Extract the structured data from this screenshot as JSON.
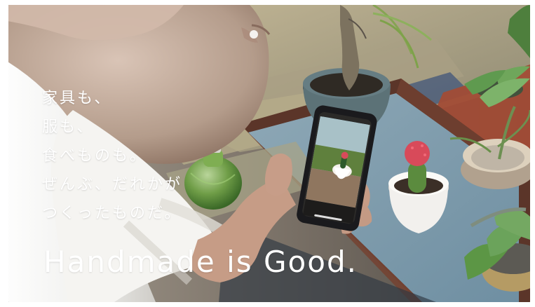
{
  "hero": {
    "copy_lines": [
      "家具も、",
      "服も、",
      "食べものも。",
      "ぜんぶ、だれかが",
      "つくったものだ。"
    ],
    "tagline": "Handmade is Good."
  },
  "colors": {
    "text": "#ffffff",
    "table_blue": "#7f9eaf",
    "table_wood": "#6a3d2d",
    "tatami": "#b8ad8c",
    "plant_green": "#5b8b3e",
    "cactus_red": "#d84a5a"
  }
}
